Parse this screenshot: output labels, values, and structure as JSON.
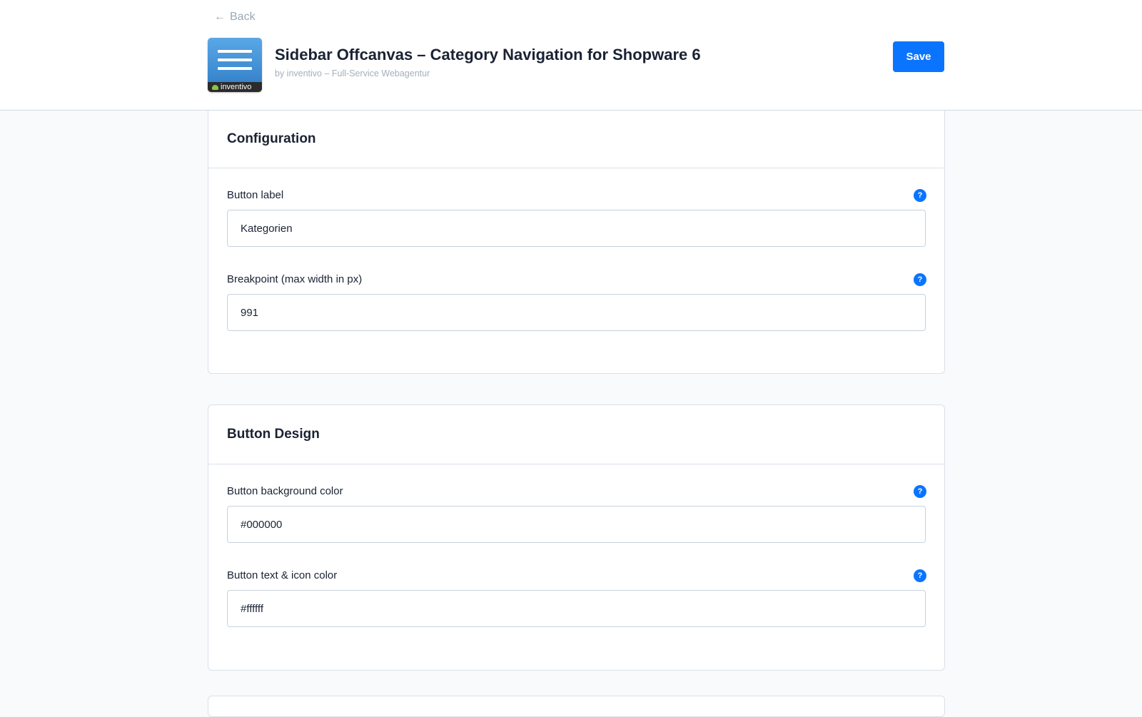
{
  "header": {
    "back_label": "Back",
    "title": "Sidebar Offcanvas – Category Navigation for Shopware 6",
    "subtitle": "by inventivo – Full-Service Webagentur",
    "logo_brand": "inventivo",
    "save_label": "Save"
  },
  "sections": [
    {
      "title": "Configuration",
      "fields": [
        {
          "label": "Button label",
          "value": "Kategorien",
          "help_icon": "?"
        },
        {
          "label": "Breakpoint (max width in px)",
          "value": "991",
          "help_icon": "?"
        }
      ]
    },
    {
      "title": "Button Design",
      "fields": [
        {
          "label": "Button background color",
          "value": "#000000",
          "help_icon": "?"
        },
        {
          "label": "Button text & icon color",
          "value": "#ffffff",
          "help_icon": "?"
        }
      ]
    }
  ],
  "icons": {
    "back": "arrow-left-icon",
    "help": "question-circle-icon",
    "logo": "hamburger-menu-logo"
  },
  "colors": {
    "accent": "#0b74ff",
    "background": "#f9fafb",
    "border": "#d9e1e8"
  }
}
